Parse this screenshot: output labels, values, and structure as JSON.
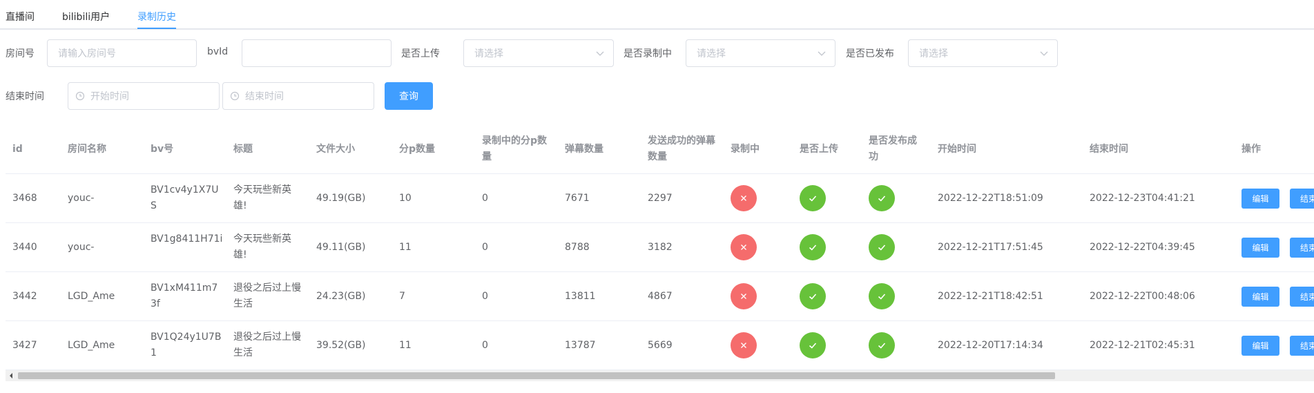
{
  "tabs": [
    {
      "label": "直播间",
      "active": false
    },
    {
      "label": "bilibili用户",
      "active": false
    },
    {
      "label": "录制历史",
      "active": true
    }
  ],
  "filters": {
    "room_label": "房间号",
    "room_placeholder": "请输入房间号",
    "bvid_label": "bvId",
    "bvid_value": "",
    "upload_label": "是否上传",
    "upload_placeholder": "请选择",
    "recording_label": "是否录制中",
    "recording_placeholder": "请选择",
    "published_label": "是否已发布",
    "published_placeholder": "请选择",
    "endtime_label": "结束时间",
    "start_placeholder": "开始时间",
    "end_placeholder": "结束时间",
    "query_label": "查询"
  },
  "table": {
    "headers": {
      "id": "id",
      "room_name": "房间名称",
      "bv": "bv号",
      "title": "标题",
      "size": "文件大小",
      "parts": "分p数量",
      "recording_parts_1": "录制中的分p数",
      "recording_parts_2": "量",
      "danmaku": "弹幕数量",
      "sent_1": "发送成功的弹幕",
      "sent_2": "数量",
      "recording": "录制中",
      "uploaded": "是否上传",
      "published_1": "是否发布成",
      "published_2": "功",
      "start": "开始时间",
      "end": "结束时间",
      "ops": "操作"
    },
    "edit_label": "编辑",
    "end_label": "结束",
    "rows": [
      {
        "id": "3468",
        "room": "youc-",
        "bv1": "BV1cv4y1X7U",
        "bv2": "S",
        "title1": "今天玩些新英",
        "title2": "雄!",
        "size": "49.19(GB)",
        "parts": "10",
        "rec_parts": "0",
        "danmaku": "7671",
        "sent": "2297",
        "recording": false,
        "uploaded": true,
        "published": true,
        "start": "2022-12-22T18:51:09",
        "end": "2022-12-23T04:41:21"
      },
      {
        "id": "3440",
        "room": "youc-",
        "bv1": "BV1g8411H71i",
        "bv2": "",
        "title1": "今天玩些新英",
        "title2": "雄!",
        "size": "49.11(GB)",
        "parts": "11",
        "rec_parts": "0",
        "danmaku": "8788",
        "sent": "3182",
        "recording": false,
        "uploaded": true,
        "published": true,
        "start": "2022-12-21T17:51:45",
        "end": "2022-12-22T04:39:45"
      },
      {
        "id": "3442",
        "room": "LGD_Ame",
        "bv1": "BV1xM411m7",
        "bv2": "3f",
        "title1": "退役之后过上慢",
        "title2": "生活",
        "size": "24.23(GB)",
        "parts": "7",
        "rec_parts": "0",
        "danmaku": "13811",
        "sent": "4867",
        "recording": false,
        "uploaded": true,
        "published": true,
        "start": "2022-12-21T18:42:51",
        "end": "2022-12-22T00:48:06"
      },
      {
        "id": "3427",
        "room": "LGD_Ame",
        "bv1": "BV1Q24y1U7B",
        "bv2": "1",
        "title1": "退役之后过上慢",
        "title2": "生活",
        "size": "39.52(GB)",
        "parts": "11",
        "rec_parts": "0",
        "danmaku": "13787",
        "sent": "5669",
        "recording": false,
        "uploaded": true,
        "published": true,
        "start": "2022-12-20T17:14:34",
        "end": "2022-12-21T02:45:31"
      }
    ]
  },
  "colors": {
    "primary": "#409eff",
    "success": "#67c23a",
    "danger": "#f56c6c"
  }
}
